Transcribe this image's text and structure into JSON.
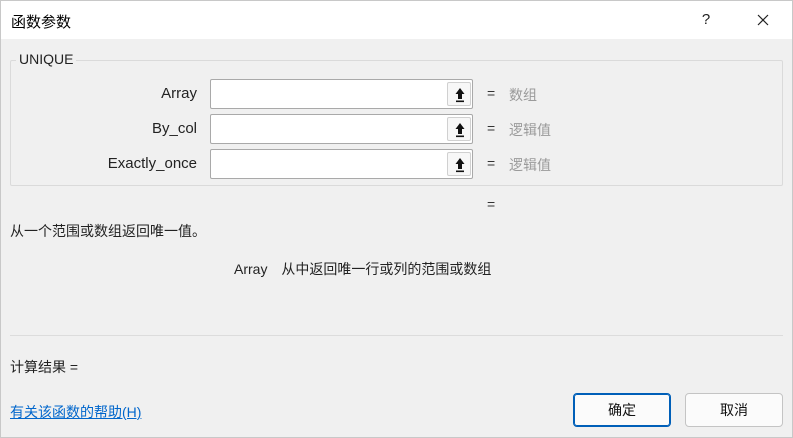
{
  "window": {
    "title": "函数参数",
    "help_label": "?",
    "close_icon": "close-icon"
  },
  "function": {
    "name": "UNIQUE",
    "result_eq": "=",
    "description": "从一个范围或数组返回唯一值。"
  },
  "args": [
    {
      "label": "Array",
      "value": "",
      "eq": "=",
      "hint": "数组"
    },
    {
      "label": "By_col",
      "value": "",
      "eq": "=",
      "hint": "逻辑值"
    },
    {
      "label": "Exactly_once",
      "value": "",
      "eq": "=",
      "hint": "逻辑值"
    }
  ],
  "arg_help": {
    "name": "Array",
    "text": "从中返回唯一行或列的范围或数组"
  },
  "footer": {
    "calc_result": "计算结果 =",
    "help_link": "有关该函数的帮助(H)",
    "ok_label": "确定",
    "cancel_label": "取消"
  },
  "colors": {
    "accent": "#005fb8",
    "link": "#0066cc",
    "hint_text": "#9a9a9a"
  }
}
